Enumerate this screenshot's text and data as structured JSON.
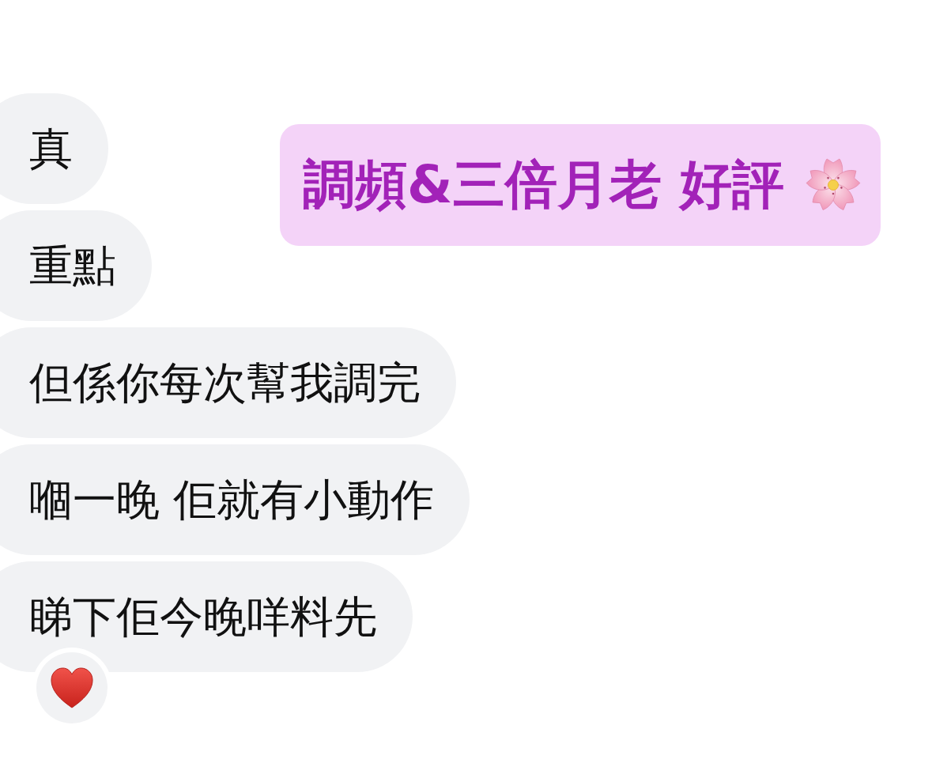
{
  "messages": [
    {
      "text": "真",
      "has_reaction": false
    },
    {
      "text": "重點",
      "has_reaction": false
    },
    {
      "text": "但係你每次幫我調完",
      "has_reaction": false
    },
    {
      "text": "嗰一晚 佢就有小動作",
      "has_reaction": false
    },
    {
      "text": "睇下佢今晚咩料先",
      "has_reaction": true
    }
  ],
  "sticker": {
    "text": "調頻&三倍月老 好評"
  }
}
